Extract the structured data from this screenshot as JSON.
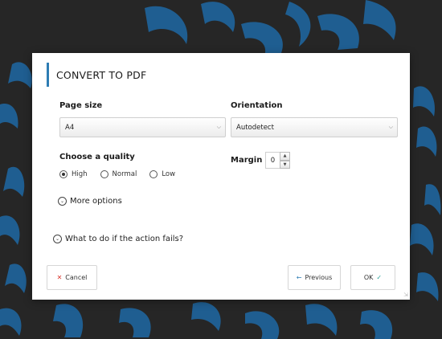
{
  "dialog": {
    "title": "CONVERT TO PDF",
    "page_size": {
      "label": "Page size",
      "value": "A4"
    },
    "orientation": {
      "label": "Orientation",
      "value": "Autodetect"
    },
    "quality": {
      "label": "Choose a quality",
      "options": [
        {
          "label": "High",
          "selected": true
        },
        {
          "label": "Normal",
          "selected": false
        },
        {
          "label": "Low",
          "selected": false
        }
      ]
    },
    "margin": {
      "label": "Margin",
      "value": "0"
    },
    "more_options": "More options",
    "on_fail": "What to do if the action fails?",
    "buttons": {
      "cancel": "Cancel",
      "previous": "Previous",
      "ok": "OK"
    }
  },
  "colors": {
    "accent": "#2e7db4",
    "background": "#262626",
    "art": "#1f5e91",
    "cancel_x": "#d9342b",
    "ok_check": "#2aa198"
  },
  "icons": [
    "select-caret-icon",
    "radio-icon",
    "chevron-down-icon",
    "close-icon",
    "arrow-left-icon",
    "check-icon",
    "resize-grip-icon"
  ]
}
